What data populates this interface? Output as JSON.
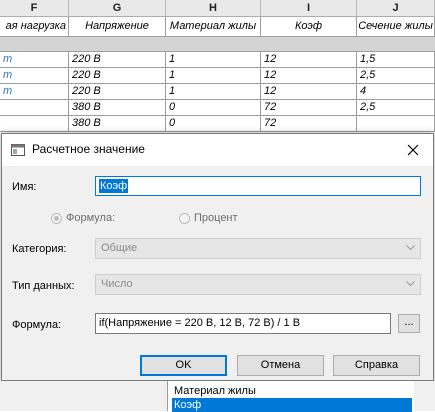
{
  "sheet": {
    "columns": [
      "F",
      "G",
      "H",
      "I",
      "J"
    ],
    "fields": [
      "ая нагрузка",
      "Напряжение",
      "Материал жилы",
      "Коэф",
      "Сечение жилы"
    ],
    "rows": [
      [
        "т",
        "220 В",
        "1",
        "12",
        "1,5"
      ],
      [
        "т",
        "220 В",
        "1",
        "12",
        "2,5"
      ],
      [
        "т",
        "220 В",
        "1",
        "12",
        "4"
      ],
      [
        "",
        "380 В",
        "0",
        "72",
        "2,5"
      ],
      [
        "",
        "380 В",
        "0",
        "72",
        ""
      ]
    ]
  },
  "dialog": {
    "title": "Расчетное значение",
    "name_label": "Имя:",
    "name_value": "Коэф",
    "radio_formula": "Формула:",
    "radio_percent": "Процент",
    "category_label": "Категория:",
    "category_value": "Общие",
    "datatype_label": "Тип данных:",
    "datatype_value": "Число",
    "formula_label": "Формула:",
    "formula_value": "if(Напряжение = 220 В, 12 В, 72 В) / 1 В",
    "ellipsis": "...",
    "ok": "OK",
    "cancel": "Отмена",
    "help": "Справка"
  },
  "list": {
    "items": [
      "Материал жилы",
      "Коэф"
    ],
    "selected": "Коэф"
  }
}
